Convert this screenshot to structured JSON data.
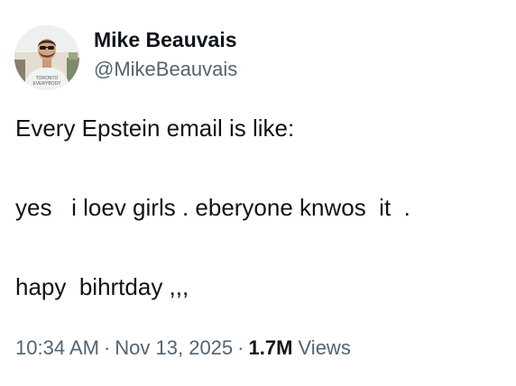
{
  "author": {
    "display_name": "Mike Beauvais",
    "handle": "@MikeBeauvais",
    "avatar_icon": "profile-photo-icon"
  },
  "tweet": {
    "lines": [
      "Every Epstein email is like:",
      "yes   i loev girls . eberyone knwos  it  .",
      "hapy  bihrtday ,,,"
    ]
  },
  "meta": {
    "time": "10:34 AM",
    "separator": "·",
    "date": "Nov 13, 2025",
    "views_count": "1.7M",
    "views_label": "Views"
  },
  "colors": {
    "primary_text": "#0f1419",
    "secondary_text": "#536471",
    "background": "#ffffff"
  }
}
